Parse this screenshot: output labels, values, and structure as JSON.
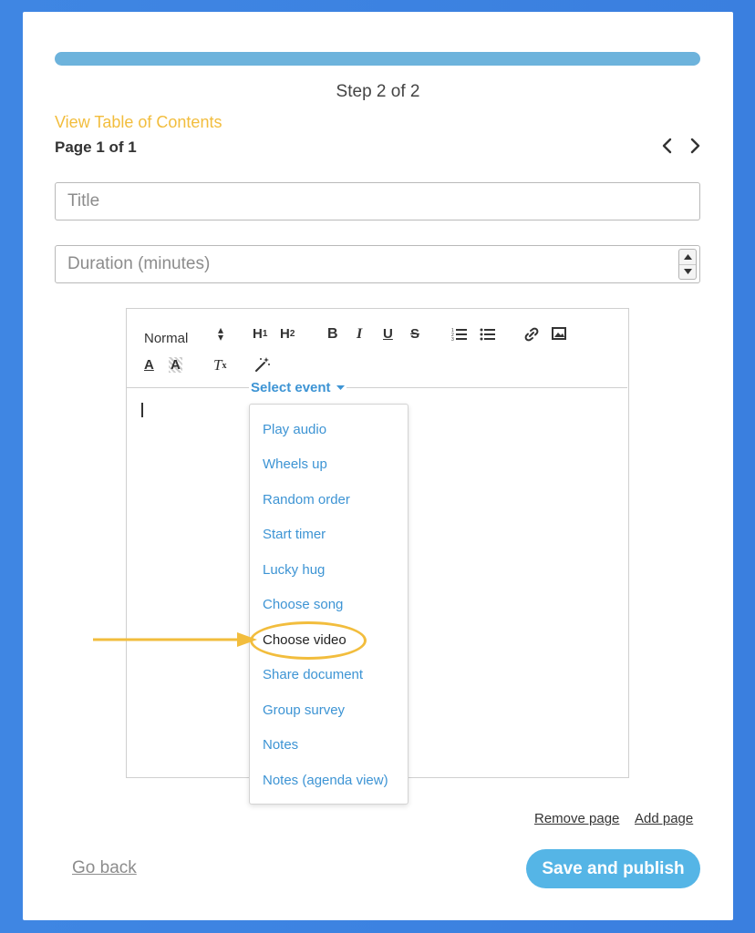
{
  "header": {
    "step_label": "Step 2 of 2",
    "toc_link": "View Table of Contents",
    "page_label": "Page 1 of 1",
    "progress": 1.0
  },
  "form": {
    "title_placeholder": "Title",
    "duration_placeholder": "Duration (minutes)"
  },
  "toolbar": {
    "format_select": "Normal",
    "h1": "H",
    "h1_sub": "1",
    "h2": "H",
    "h2_sub": "2",
    "bold": "B",
    "italic": "I",
    "underline": "U",
    "strike": "S",
    "font_color": "A",
    "background_color": "A",
    "clear_format": "T",
    "clear_format_sub": "x"
  },
  "event_menu": {
    "label": "Select event",
    "items": [
      "Play audio",
      "Wheels up",
      "Random order",
      "Start timer",
      "Lucky hug",
      "Choose song",
      "Choose video",
      "Share document",
      "Group survey",
      "Notes",
      "Notes (agenda view)"
    ],
    "highlighted_index": 6
  },
  "page_actions": {
    "remove": "Remove page",
    "add": "Add page"
  },
  "footer": {
    "go_back": "Go back",
    "save": "Save and publish"
  },
  "colors": {
    "background": "#3a7fdf",
    "progress": "#6db3dc",
    "accent_yellow": "#f2bd3d",
    "link_blue": "#3d94d4",
    "save_button": "#55b5e6"
  },
  "icons": [
    "chevron-left-icon",
    "chevron-right-icon",
    "ordered-list-icon",
    "bullet-list-icon",
    "link-icon",
    "image-icon",
    "magic-wand-icon",
    "caret-down-icon",
    "arrow-right-icon"
  ]
}
